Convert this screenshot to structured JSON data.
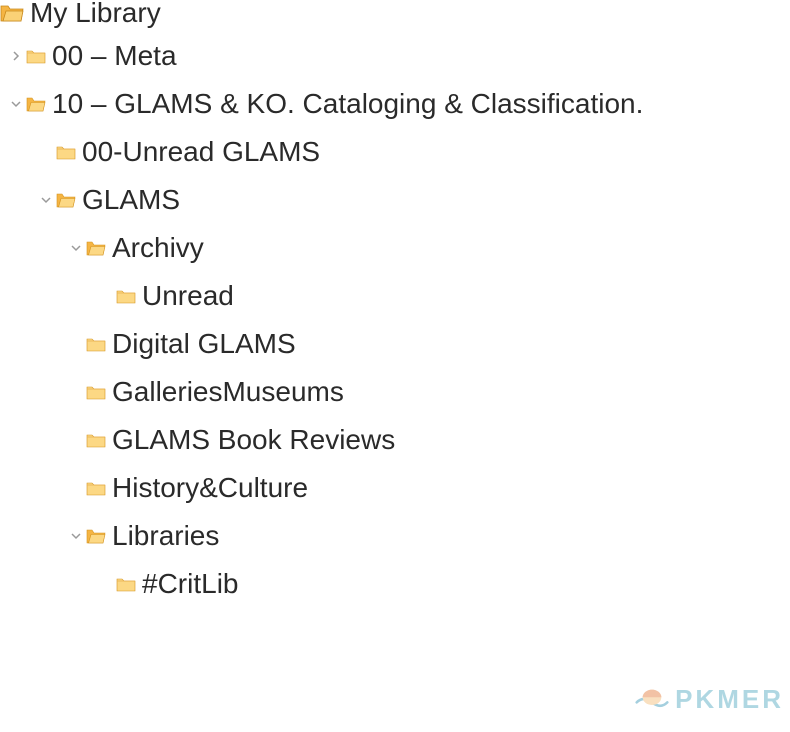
{
  "tree": {
    "root": {
      "label": "My Library",
      "expanded": true
    },
    "items": [
      {
        "label": "00 – Meta",
        "depth": 1,
        "hasChildren": true,
        "expanded": false,
        "open": false
      },
      {
        "label": "10 – GLAMS & KO. Cataloging & Classification.",
        "depth": 1,
        "hasChildren": true,
        "expanded": true,
        "open": true
      },
      {
        "label": "00-Unread GLAMS",
        "depth": 2,
        "hasChildren": false,
        "expanded": false,
        "open": false
      },
      {
        "label": "GLAMS",
        "depth": 2,
        "hasChildren": true,
        "expanded": true,
        "open": true
      },
      {
        "label": "Archivy",
        "depth": 3,
        "hasChildren": true,
        "expanded": true,
        "open": true
      },
      {
        "label": "Unread",
        "depth": 4,
        "hasChildren": false,
        "expanded": false,
        "open": false
      },
      {
        "label": "Digital GLAMS",
        "depth": 3,
        "hasChildren": false,
        "expanded": false,
        "open": false
      },
      {
        "label": "GalleriesMuseums",
        "depth": 3,
        "hasChildren": false,
        "expanded": false,
        "open": false
      },
      {
        "label": "GLAMS Book Reviews",
        "depth": 3,
        "hasChildren": false,
        "expanded": false,
        "open": false
      },
      {
        "label": "History&Culture",
        "depth": 3,
        "hasChildren": false,
        "expanded": false,
        "open": false
      },
      {
        "label": "Libraries",
        "depth": 3,
        "hasChildren": true,
        "expanded": true,
        "open": true
      },
      {
        "label": "#CritLib",
        "depth": 4,
        "hasChildren": false,
        "expanded": false,
        "open": false
      }
    ]
  },
  "watermark": {
    "text": "PKMER"
  },
  "layout": {
    "indentBase": 8,
    "indentStep": 30
  }
}
